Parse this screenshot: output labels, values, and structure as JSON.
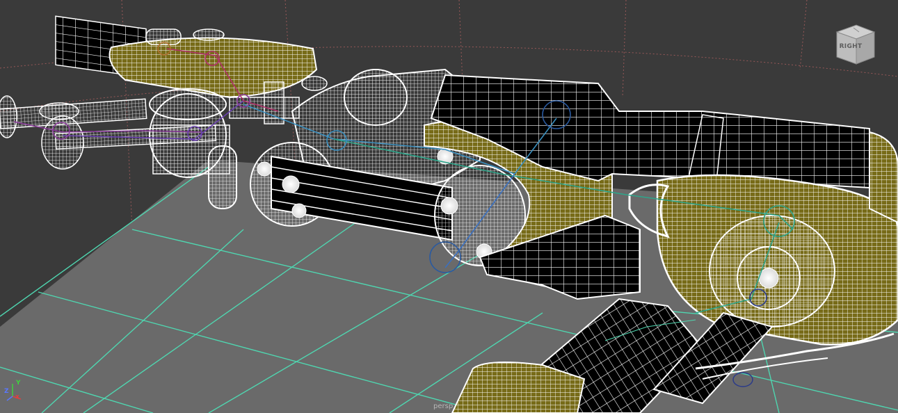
{
  "viewport": {
    "background_color": "#3a3a3a",
    "ground_color": "#6a6a6a",
    "grid_color": "#4fd6b0",
    "far_grid_color": "#b06060",
    "wire_color": "#ffffff",
    "accent_fill": "#776b18",
    "camera_label": "persp"
  },
  "viewcube": {
    "face_label": "RIGHT",
    "icon": "viewcube-icon"
  },
  "axis_indicator": {
    "x_label": "x",
    "y_label": "Y",
    "z_label": "Z",
    "x_color": "#e04040",
    "y_color": "#40d040",
    "z_color": "#5a78ff"
  }
}
